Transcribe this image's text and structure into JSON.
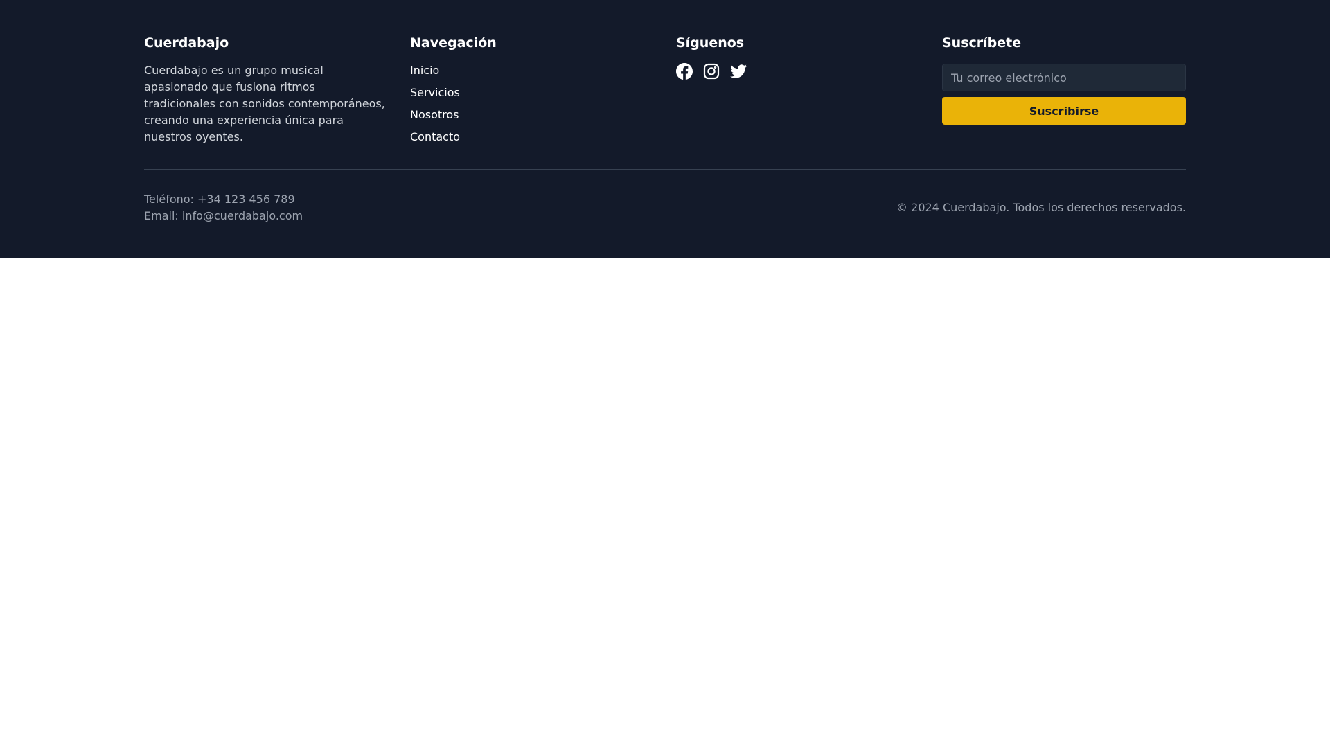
{
  "brand": {
    "name": "Cuerdabajo",
    "description": "Cuerdabajo es un grupo musical apasionado que fusiona ritmos tradicionales con sonidos contemporáneos, creando una experiencia única para nuestros oyentes."
  },
  "navigation": {
    "title": "Navegación",
    "items": [
      {
        "label": "Inicio"
      },
      {
        "label": "Servicios"
      },
      {
        "label": "Nosotros"
      },
      {
        "label": "Contacto"
      }
    ]
  },
  "social": {
    "title": "Síguenos",
    "icons": [
      "facebook-icon",
      "instagram-icon",
      "twitter-icon"
    ]
  },
  "subscribe": {
    "title": "Suscríbete",
    "email_placeholder": "Tu correo electrónico",
    "email_value": "",
    "button_label": "Suscribirse"
  },
  "contact": {
    "phone": "Teléfono: +34 123 456 789",
    "email": "Email: info@cuerdabajo.com"
  },
  "copyright": "© 2024 Cuerdabajo. Todos los derechos reservados.",
  "colors": {
    "footer_background": "#131a2a",
    "accent": "#eab308",
    "muted_text": "#9ca3af",
    "input_background": "#1f2937",
    "page_background": "#ffffff"
  }
}
